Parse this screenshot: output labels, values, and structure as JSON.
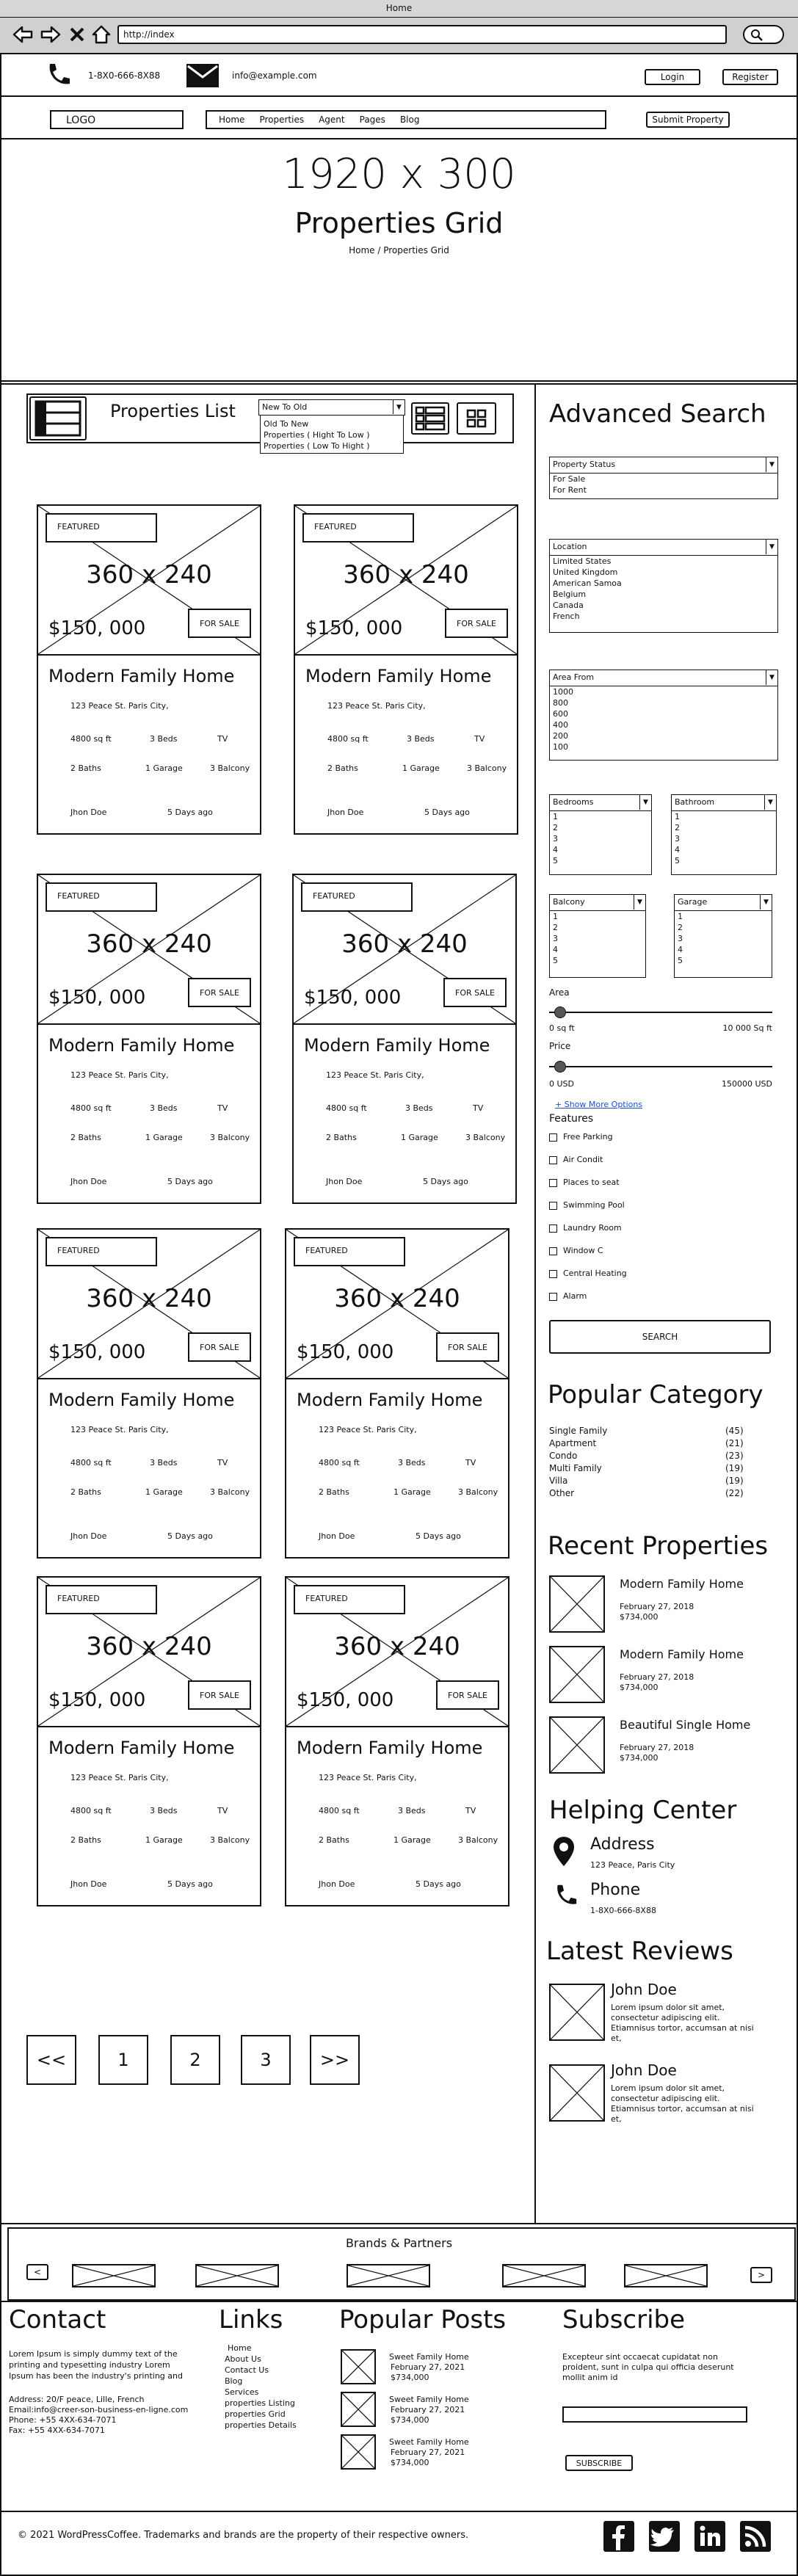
{
  "browser": {
    "title": "Home",
    "url": "http://index"
  },
  "topbar": {
    "phone": "1-8X0-666-8X88",
    "email": "info@example.com",
    "login": "Login",
    "register": "Register"
  },
  "nav": {
    "logo": "LOGO",
    "items": [
      "Home",
      "Properties",
      "Agent",
      "Pages",
      "Blog"
    ],
    "submit": "Submit Property"
  },
  "hero": {
    "size": "1920 x 300",
    "title": "Properties Grid",
    "breadcrumb": "Home / Properties Grid"
  },
  "list": {
    "title": "Properties List",
    "sort_selected": "New To Old",
    "sort_options": [
      "Old To New",
      "Properties ( Hight To Low )",
      "Properties (  Low To Hight )"
    ]
  },
  "card": {
    "badge": "FEATURED",
    "img_size": "360 x 240",
    "price": "$150, 000",
    "status": "FOR SALE",
    "title": "Modern Family Home",
    "address": "123 Peace St. Paris City,",
    "area": "4800 sq ft",
    "beds": "3 Beds",
    "tv": "TV",
    "baths": "2 Baths",
    "garage": "1 Garage",
    "balcony": "3 Balcony",
    "agent": "Jhon Doe",
    "date": "5 Days ago"
  },
  "pagination": [
    "<<",
    "1",
    "2",
    "3",
    ">>"
  ],
  "search": {
    "title": "Advanced Search",
    "status": {
      "label": "Property Status",
      "options": [
        "For Sale",
        "For Rent"
      ]
    },
    "location": {
      "label": "Location",
      "options": [
        "Limited States",
        "United Kingdom",
        "American Samoa",
        "Belgium",
        "Canada",
        "French"
      ]
    },
    "area": {
      "label": "Area From",
      "options": [
        "1000",
        "800",
        "600",
        "400",
        "200",
        "100"
      ]
    },
    "bedrooms": {
      "label": "Bedrooms",
      "options": [
        "1",
        "2",
        "3",
        "4",
        "5"
      ]
    },
    "bathroom": {
      "label": "Bathroom",
      "options": [
        "1",
        "2",
        "3",
        "4",
        "5"
      ]
    },
    "balcony": {
      "label": "Balcony",
      "options": [
        "1",
        "2",
        "3",
        "4",
        "5"
      ]
    },
    "garage": {
      "label": "Garage",
      "options": [
        "1",
        "2",
        "3",
        "4",
        "5"
      ]
    },
    "area_slider": {
      "label": "Area",
      "min": "0 sq ft",
      "max": "10 000 Sq ft",
      "value": 0.05
    },
    "price_slider": {
      "label": "Price",
      "min": "0 USD",
      "max": "150000 USD",
      "value": 0.05
    },
    "more": "+ Show More Options",
    "features_title": "Features",
    "features": [
      "Free Parking",
      "Air Condit",
      "Places to seat",
      "Swimming Pool",
      "Laundry Room",
      "Window C",
      "Central Heating",
      "Alarm"
    ],
    "button": "SEARCH"
  },
  "category": {
    "title": "Popular Category",
    "items": [
      {
        "name": "Single Family",
        "count": "(45)"
      },
      {
        "name": "Apartment",
        "count": "(21)"
      },
      {
        "name": "Condo",
        "count": "(23)"
      },
      {
        "name": "Multi Family",
        "count": "(19)"
      },
      {
        "name": "Villa",
        "count": "(19)"
      },
      {
        "name": "Other",
        "count": "(22)"
      }
    ]
  },
  "recent": {
    "title": "Recent Properties",
    "items": [
      {
        "name": "Modern Family Home",
        "date": "February 27, 2018",
        "price": "$734,000"
      },
      {
        "name": "Modern Family Home",
        "date": "February 27, 2018",
        "price": "$734,000"
      },
      {
        "name": "Beautiful Single Home",
        "date": "February 27, 2018",
        "price": "$734,000"
      }
    ]
  },
  "helping": {
    "title": "Helping Center",
    "address_label": "Address",
    "address": "123 Peace, Paris City",
    "phone_label": "Phone",
    "phone": "1-8X0-666-8X88"
  },
  "reviews": {
    "title": "Latest Reviews",
    "items": [
      {
        "name": "John Doe",
        "l1": "Lorem ipsum dolor sit amet,",
        "l2": "consectetur adipiscing elit.",
        "l3": "Etiamnisus tortor, accumsan at nisi",
        "l4": "et,"
      },
      {
        "name": "John Doe",
        "l1": "Lorem ipsum dolor sit amet,",
        "l2": "consectetur adipiscing elit.",
        "l3": "Etiamnisus tortor, accumsan at nisi",
        "l4": "et,"
      }
    ]
  },
  "brands": {
    "title": "Brands & Partners",
    "prev": "<",
    "next": ">"
  },
  "footer": {
    "contact": {
      "title": "Contact",
      "l1": "Lorem Ipsum is simply dummy text of the",
      "l2": "printing and typesetting industry Lorem",
      "l3": "Ipsum has been the industry's printing and",
      "addr": "Address: 20/F peace, Lille, French",
      "email": "Email:info@creer-son-business-en-ligne.com",
      "phone": "Phone: +55 4XX-634-7071",
      "fax": "Fax: +55 4XX-634-7071"
    },
    "links": {
      "title": "Links",
      "items": [
        "Home",
        "About Us",
        "Contact Us",
        "Blog",
        "Services",
        "properties Listing",
        "properties Grid",
        "properties Details"
      ]
    },
    "posts": {
      "title": "Popular Posts",
      "items": [
        {
          "name": "Sweet Family Home",
          "date": "February 27, 2021",
          "price": "$734,000"
        },
        {
          "name": "Sweet Family Home",
          "date": "February 27, 2021",
          "price": "$734,000"
        },
        {
          "name": "Sweet Family Home",
          "date": "February 27, 2021",
          "price": "$734,000"
        }
      ]
    },
    "subscribe": {
      "title": "Subscribe",
      "l1": "Excepteur sint occaecat cupidatat non",
      "l2": "proident, sunt in culpa qui officia deserunt",
      "l3": "mollit anim id",
      "button": "SUBSCRIBE"
    },
    "copyright": "© 2021 WordPressCoffee. Trademarks and brands are the property of their respective owners."
  }
}
